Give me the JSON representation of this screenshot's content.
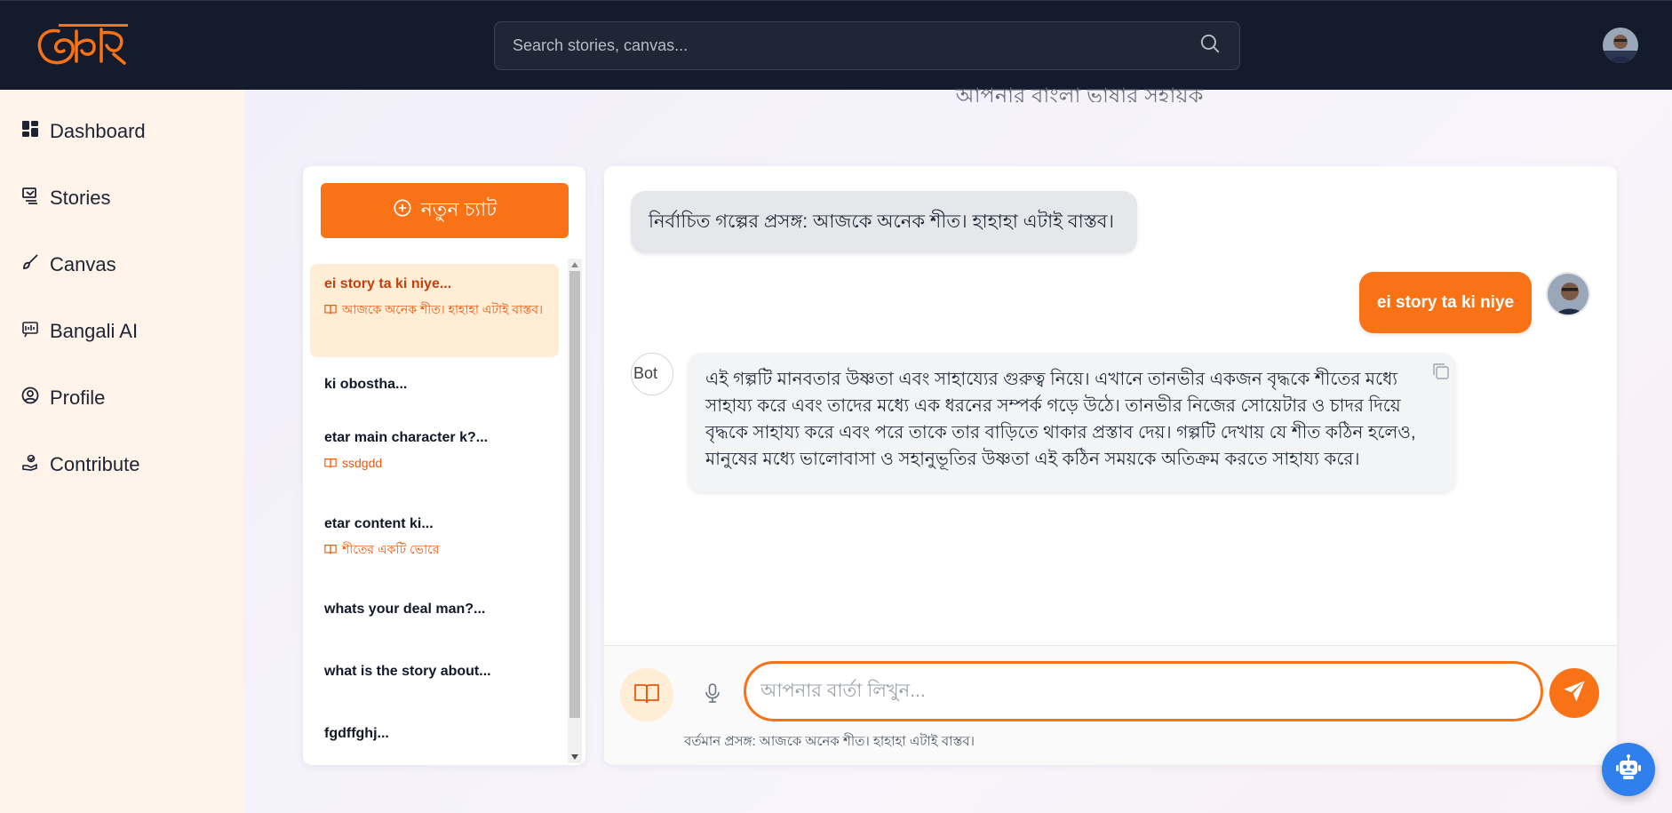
{
  "topbar": {
    "logo_text": "অক্ষর",
    "search_placeholder": "Search stories, canvas..."
  },
  "sidebar": {
    "items": [
      {
        "label": "Dashboard",
        "icon": "dashboard-icon"
      },
      {
        "label": "Stories",
        "icon": "stories-icon"
      },
      {
        "label": "Canvas",
        "icon": "brush-icon"
      },
      {
        "label": "Bangali AI",
        "icon": "ai-chip-icon"
      },
      {
        "label": "Profile",
        "icon": "user-circle-icon"
      },
      {
        "label": "Contribute",
        "icon": "contribute-icon"
      }
    ]
  },
  "main": {
    "subtitle": "আপনার বাংলা ভাষার সহায়ক"
  },
  "chat_list": {
    "new_chat_label": "নতুন চ্যাট",
    "items": [
      {
        "title": "ei story ta ki niye...",
        "context": "আজকে অনেক শীত। হাহাহা এটাই বাস্তব।",
        "active": true
      },
      {
        "title": "ki obostha...",
        "context": ""
      },
      {
        "title": "etar main character k?...",
        "context": "ssdgdd"
      },
      {
        "title": "etar content ki...",
        "context": "শীতের একটি ভোরে"
      },
      {
        "title": "whats your deal man?...",
        "context": ""
      },
      {
        "title": "what is the story about...",
        "context": ""
      },
      {
        "title": "fgdffghj...",
        "context": ""
      }
    ]
  },
  "conversation": {
    "context_message": "নির্বাচিত গল্পের প্রসঙ্গ: আজকে অনেক শীত। হাহাহা এটাই বাস্তব।",
    "user_message": "ei story ta ki niye",
    "bot_avatar_alt": "Bot",
    "bot_message": "এই গল্পটি মানবতার উষ্ণতা এবং সাহায্যের গুরুত্ব নিয়ে। এখানে তানভীর একজন বৃদ্ধকে শীতের মধ্যে সাহায্য করে এবং তাদের মধ্যে এক ধরনের সম্পর্ক গড়ে উঠে। তানভীর নিজের সোয়েটার ও চাদর দিয়ে বৃদ্ধকে সাহায্য করে এবং পরে তাকে তার বাড়িতে থাকার প্রস্তাব দেয়। গল্পটি দেখায় যে শীত কঠিন হলেও, মানুষের মধ্যে ভালোবাসা ও সহানুভূতির উষ্ণতা এই কঠিন সময়কে অতিক্রম করতে সাহায্য করে।",
    "input_placeholder": "আপনার বার্তা লিখুন...",
    "context_note": "বর্তমান প্রসঙ্গ: আজকে অনেক শীত। হাহাহা এটাই বাস্তব।"
  },
  "colors": {
    "accent": "#f97316",
    "topbar": "#131b2d",
    "sidebar": "#fff3ea",
    "fab": "#2f80ed"
  }
}
